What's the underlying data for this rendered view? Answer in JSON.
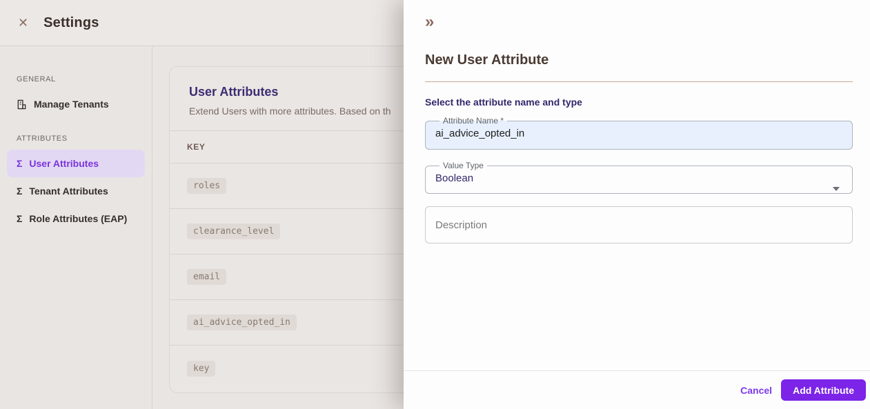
{
  "colors": {
    "accent_purple": "#7c24e8",
    "link_purple": "#7c3aed",
    "selected_nav_bg": "#e3d8f4",
    "selected_nav_text": "#7a33db",
    "heading_indigo": "#32276b",
    "card_title_indigo": "#3e2c72",
    "drawer_divider_tan": "#c9a795",
    "name_field_bg": "#e7f0fc"
  },
  "icons": {
    "close": "✕",
    "collapse": "»",
    "sigma": "Σ"
  },
  "header": {
    "title": "Settings"
  },
  "sidebar": {
    "sections": [
      {
        "label": "GENERAL",
        "items": [
          {
            "label": "Manage Tenants",
            "icon": "building-icon",
            "selected": false
          }
        ]
      },
      {
        "label": "ATTRIBUTES",
        "items": [
          {
            "label": "User Attributes",
            "icon": "sigma-icon",
            "selected": true
          },
          {
            "label": "Tenant Attributes",
            "icon": "sigma-icon",
            "selected": false
          },
          {
            "label": "Role Attributes (EAP)",
            "icon": "sigma-icon",
            "selected": false
          }
        ]
      }
    ]
  },
  "main": {
    "card": {
      "title": "User Attributes",
      "subtitle": "Extend Users with more attributes. Based on th",
      "table": {
        "columns": [
          "KEY"
        ],
        "rows": [
          "roles",
          "clearance_level",
          "email",
          "ai_advice_opted_in",
          "key"
        ]
      }
    }
  },
  "drawer": {
    "title": "New User Attribute",
    "section_heading": "Select the attribute name and type",
    "fields": {
      "attribute_name": {
        "label": "Attribute Name *",
        "value": "ai_advice_opted_in"
      },
      "value_type": {
        "label": "Value Type",
        "value": "Boolean"
      },
      "description": {
        "placeholder": "Description",
        "value": ""
      }
    },
    "footer": {
      "cancel_label": "Cancel",
      "submit_label": "Add Attribute"
    }
  }
}
